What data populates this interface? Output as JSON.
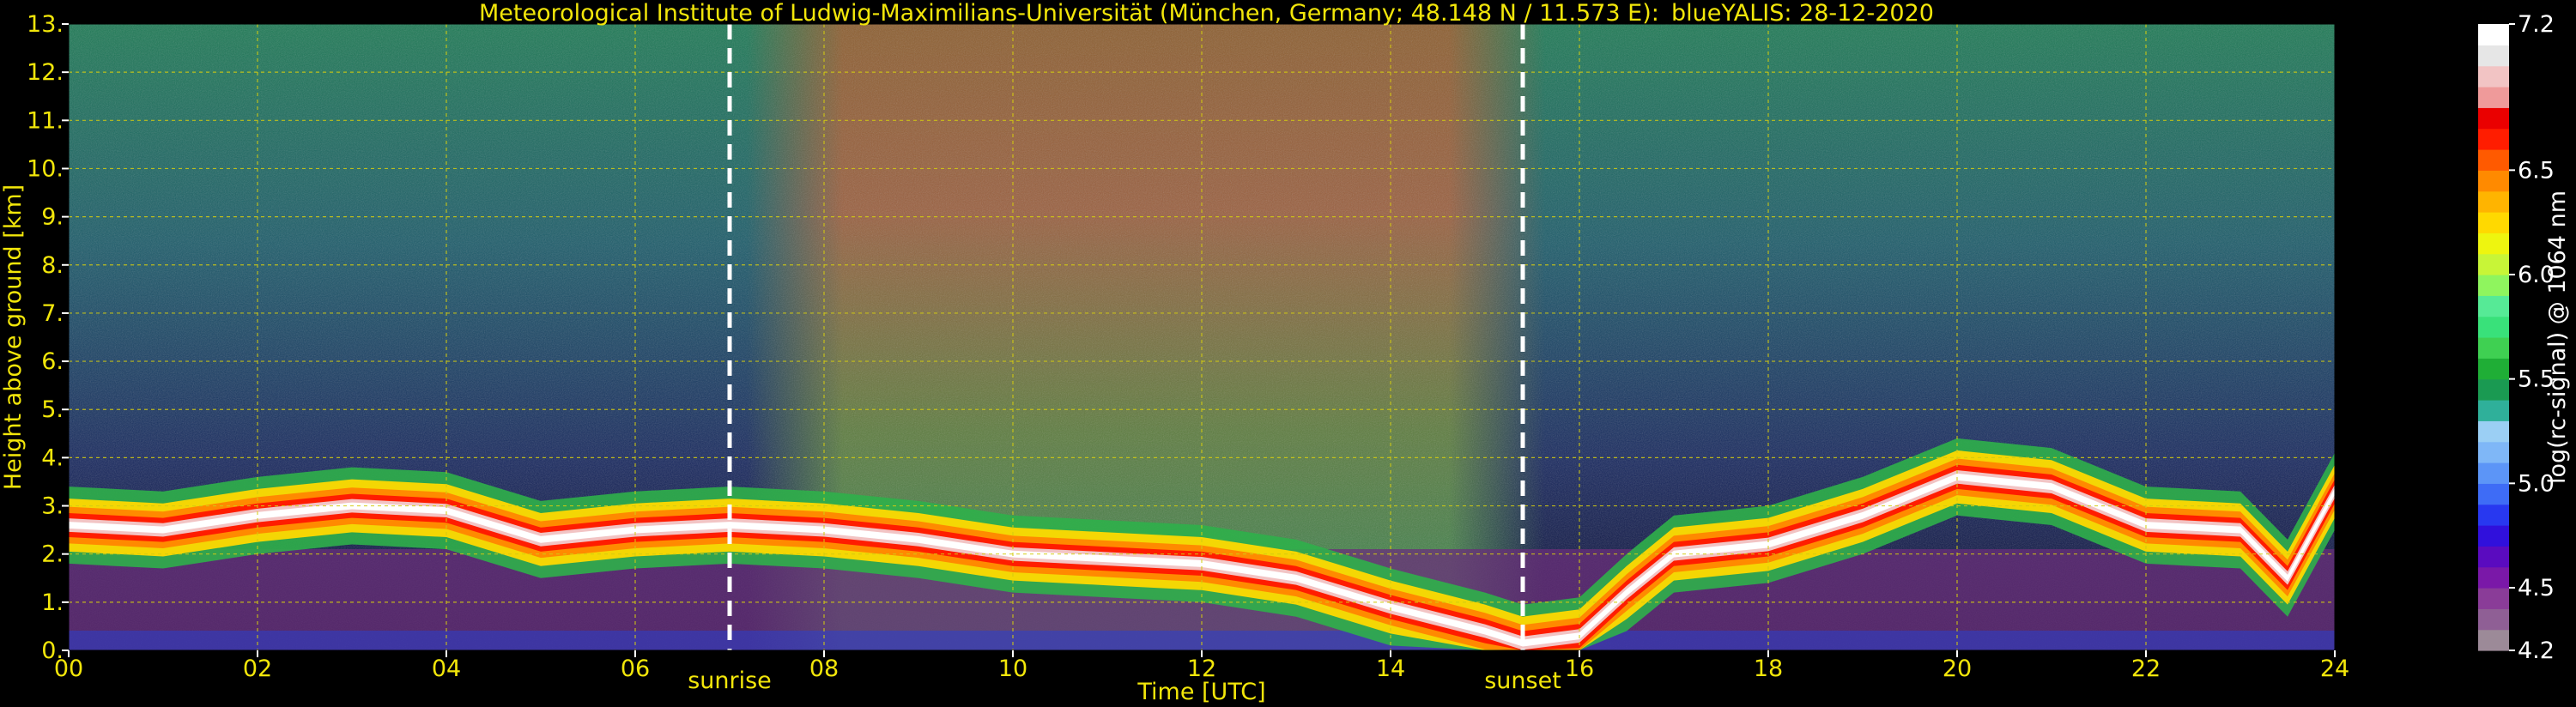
{
  "colors": {
    "background": "#000000",
    "label_text": "#f2e60a",
    "colorbar_text": "#ffffff",
    "grid": "#d4cc10",
    "marker": "#ffffff"
  },
  "chart_data": {
    "type": "heatmap",
    "title": "Meteorological Institute of Ludwig-Maximilians-Universität (München, Germany; 48.148 N / 11.573 E):",
    "subtitle": "blueYALIS: 28-12-2020",
    "xlabel": "Time [UTC]",
    "ylabel": "Height above ground [km]",
    "xlim": [
      0,
      24
    ],
    "ylim": [
      0,
      13
    ],
    "grid": true,
    "x_ticks": [
      0,
      2,
      4,
      6,
      8,
      10,
      12,
      14,
      16,
      18,
      20,
      22,
      24
    ],
    "x_tick_labels": [
      "00",
      "02",
      "04",
      "06",
      "08",
      "10",
      "12",
      "14",
      "16",
      "18",
      "20",
      "22",
      "24"
    ],
    "y_ticks": [
      0,
      1,
      2,
      3,
      4,
      5,
      6,
      7,
      8,
      9,
      10,
      11,
      12,
      13
    ],
    "y_tick_labels": [
      "0.",
      "1.",
      "2.",
      "3.",
      "4.",
      "5.",
      "6.",
      "7.",
      "8.",
      "9.",
      "10.",
      "11.",
      "12.",
      "13."
    ],
    "markers": [
      {
        "label": "sunrise",
        "x": 7.0
      },
      {
        "label": "sunset",
        "x": 15.4
      }
    ],
    "colorbar": {
      "label": "log(rc-signal) @ 1064 nm",
      "range": [
        4.2,
        7.2
      ],
      "tick_values": [
        4.2,
        4.5,
        5.0,
        5.5,
        6.0,
        6.5,
        7.2
      ],
      "tick_labels": [
        "4.2",
        "4.5",
        "5.0",
        "5.5",
        "6.0",
        "6.5",
        "7.2"
      ],
      "colors": [
        "#9c8a98",
        "#8f5f95",
        "#8a3c98",
        "#7a18a8",
        "#5a0bbf",
        "#3010dc",
        "#2838f0",
        "#3e6cf6",
        "#5c95f7",
        "#7fb7f7",
        "#9bcff4",
        "#2fb09a",
        "#1a9a52",
        "#1fae36",
        "#3fd052",
        "#39e17a",
        "#56ea96",
        "#8ff55e",
        "#c8f537",
        "#eef50f",
        "#ffd900",
        "#ffb400",
        "#ff8a00",
        "#ff5a00",
        "#ff1d00",
        "#ea0000",
        "#ef9a9a",
        "#f2c4c4",
        "#e6e6e6",
        "#ffffff"
      ]
    },
    "layer_height_km": {
      "x": [
        0,
        1,
        2,
        3,
        4,
        5,
        6,
        7,
        8,
        9,
        10,
        11,
        12,
        13,
        14,
        15,
        15.4,
        16,
        16.5,
        17,
        18,
        19,
        20,
        21,
        22,
        23,
        23.5,
        24
      ],
      "y": [
        2.6,
        2.5,
        2.8,
        3.0,
        2.9,
        2.3,
        2.5,
        2.6,
        2.5,
        2.3,
        2.0,
        1.9,
        1.8,
        1.5,
        0.9,
        0.4,
        0.15,
        0.3,
        1.2,
        2.0,
        2.2,
        2.8,
        3.6,
        3.4,
        2.6,
        2.5,
        1.5,
        3.3
      ]
    }
  }
}
